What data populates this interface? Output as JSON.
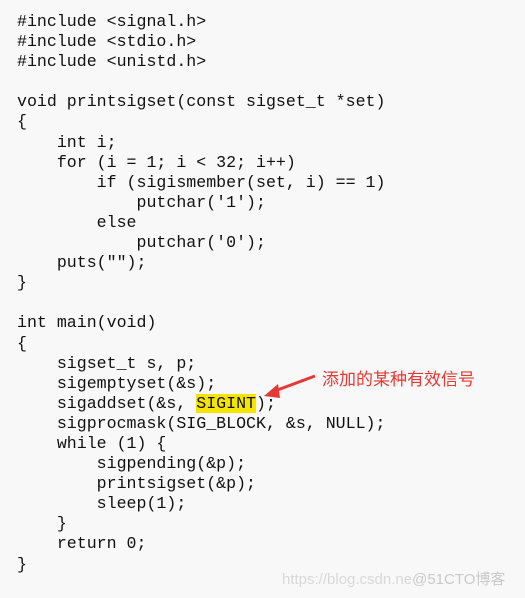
{
  "code": {
    "lines": [
      "#include <signal.h>",
      "#include <stdio.h>",
      "#include <unistd.h>",
      "",
      "void printsigset(const sigset_t *set)",
      "{",
      "    int i;",
      "    for (i = 1; i < 32; i++)",
      "        if (sigismember(set, i) == 1)",
      "            putchar('1');",
      "        else",
      "            putchar('0');",
      "    puts(\"\");",
      "}",
      "",
      "int main(void)",
      "{",
      "    sigset_t s, p;",
      "    sigemptyset(&s);",
      "    sigaddset(&s, ",
      "    sigprocmask(SIG_BLOCK, &s, NULL);",
      "    while (1) {",
      "        sigpending(&p);",
      "        printsigset(&p);",
      "        sleep(1);",
      "    }",
      "    return 0;",
      "}"
    ],
    "highlight": {
      "line": 19,
      "prefix": "    sigaddset(&s, ",
      "text": "SIGINT",
      "suffix": ");",
      "color": "#f5e400"
    }
  },
  "annotation": {
    "text": "添加的某种有效信号",
    "color": "#e53935",
    "icon": "arrow-icon"
  },
  "watermark": {
    "url": "https://blog.csdn.ne",
    "brand": "@51CTO博客"
  }
}
